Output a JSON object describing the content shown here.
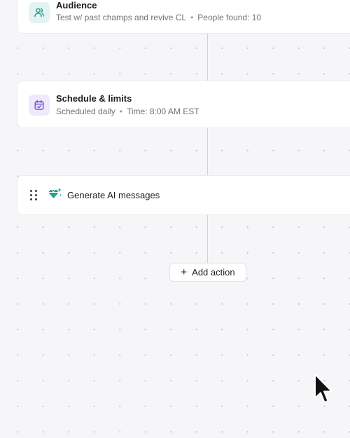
{
  "nodes": [
    {
      "title": "Audience",
      "subtitle_parts": [
        "Test w/ past champs and revive CL",
        "People found: 10"
      ],
      "icon": "people-icon",
      "icon_color": "#2a9d8f"
    },
    {
      "title": "Schedule & limits",
      "subtitle_parts": [
        "Scheduled daily",
        "Time: 8:00 AM EST"
      ],
      "icon": "calendar-check-icon",
      "icon_color": "#6b4fd8"
    },
    {
      "title": "Generate AI messages",
      "icon": "sparkle-diamond-icon",
      "icon_color": "#2a9d8f"
    }
  ],
  "add_action": {
    "icon": "plus-icon",
    "label": "Add action"
  },
  "separator": "•",
  "colors": {
    "background": "#f6f6f8",
    "card": "#ffffff",
    "teal_accent": "#2a9d8f",
    "purple_accent": "#6b4fd8"
  }
}
